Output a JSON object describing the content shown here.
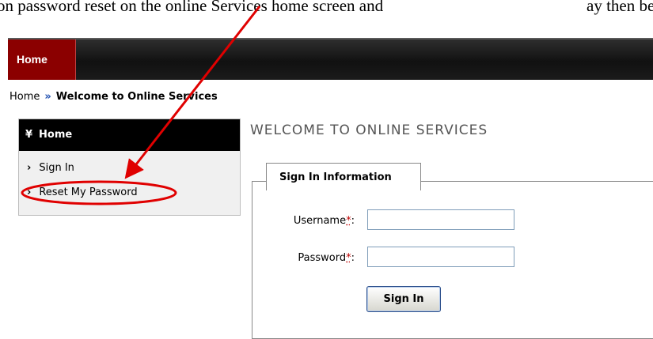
{
  "caption": {
    "left": "on password reset on the online Services home screen and",
    "right": "ay then be p"
  },
  "topnav": {
    "home_label": "Home"
  },
  "breadcrumb": {
    "home": "Home",
    "separator": "»",
    "current": "Welcome to Online Services"
  },
  "sidebar": {
    "header": "Home",
    "header_icon": "double-chevron-down-icon",
    "items": [
      {
        "label": "Sign In",
        "icon": "chevron-right-icon"
      },
      {
        "label": "Reset My Password",
        "icon": "chevron-right-icon"
      }
    ]
  },
  "main": {
    "title": "WELCOME TO ONLINE SERVICES",
    "legend": "Sign In Information",
    "username_label": "Username",
    "password_label": "Password",
    "required_marker": "*",
    "label_suffix": ":",
    "username_value": "",
    "password_value": "",
    "signin_button": "Sign In"
  },
  "colors": {
    "nav_home_bg": "#8b0000",
    "topbar_bg": "#111111",
    "annotation_red": "#e00000",
    "breadcrumb_sep": "#1f4fb0"
  }
}
